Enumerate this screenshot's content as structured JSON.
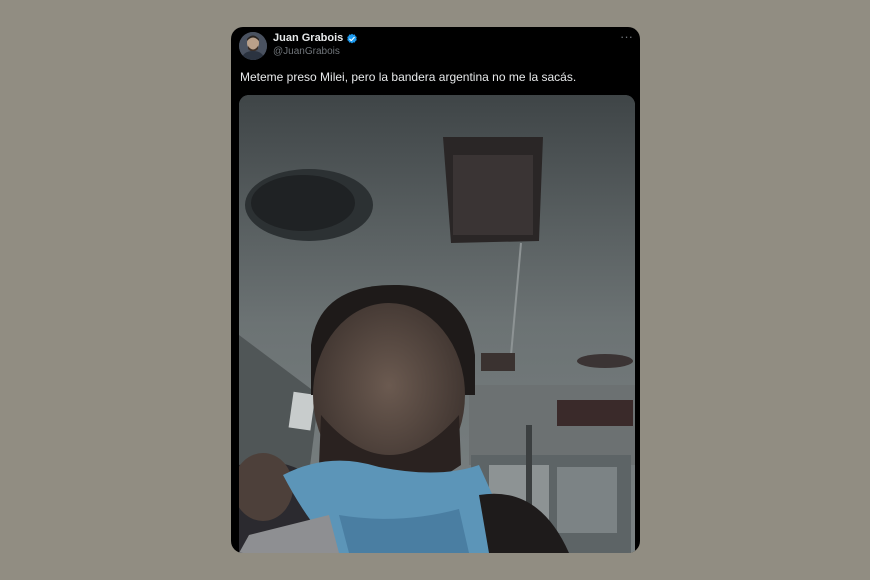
{
  "tweet": {
    "author_name": "Juan Grabois",
    "author_handle": "@JuanGrabois",
    "more_glyph": "···",
    "text": "Meteme preso Milei, pero la bandera argentina no me la sacás.",
    "verified": true,
    "accent_color": "#1d9bf0"
  },
  "page": {
    "background_color": "#918d82",
    "card_color": "#000000"
  }
}
